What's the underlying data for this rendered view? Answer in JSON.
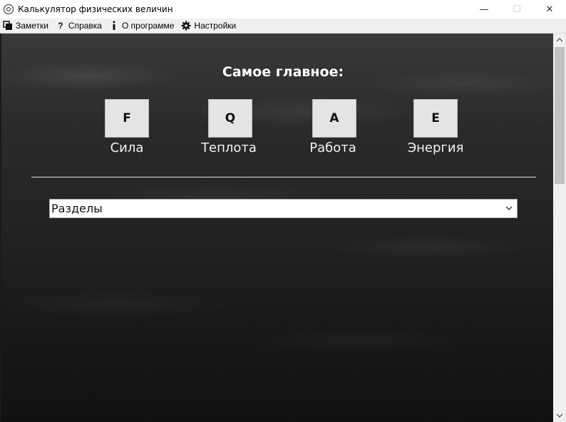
{
  "window": {
    "title": "Калькулятор физических величин",
    "controls": {
      "minimize": "—",
      "maximize": "☐",
      "close": "✕"
    }
  },
  "menu": [
    {
      "icon": "notes-icon",
      "label": "Заметки"
    },
    {
      "icon": "question-icon",
      "label": "Справка"
    },
    {
      "icon": "info-icon",
      "label": "О программе"
    },
    {
      "icon": "gear-icon",
      "label": "Настройки"
    }
  ],
  "main": {
    "section_title": "Самое главное:",
    "quick": [
      {
        "symbol": "F",
        "label": "Сила"
      },
      {
        "symbol": "Q",
        "label": "Теплота"
      },
      {
        "symbol": "A",
        "label": "Работа"
      },
      {
        "symbol": "E",
        "label": "Энергия"
      }
    ],
    "sections_select": {
      "value": "Разделы"
    }
  }
}
